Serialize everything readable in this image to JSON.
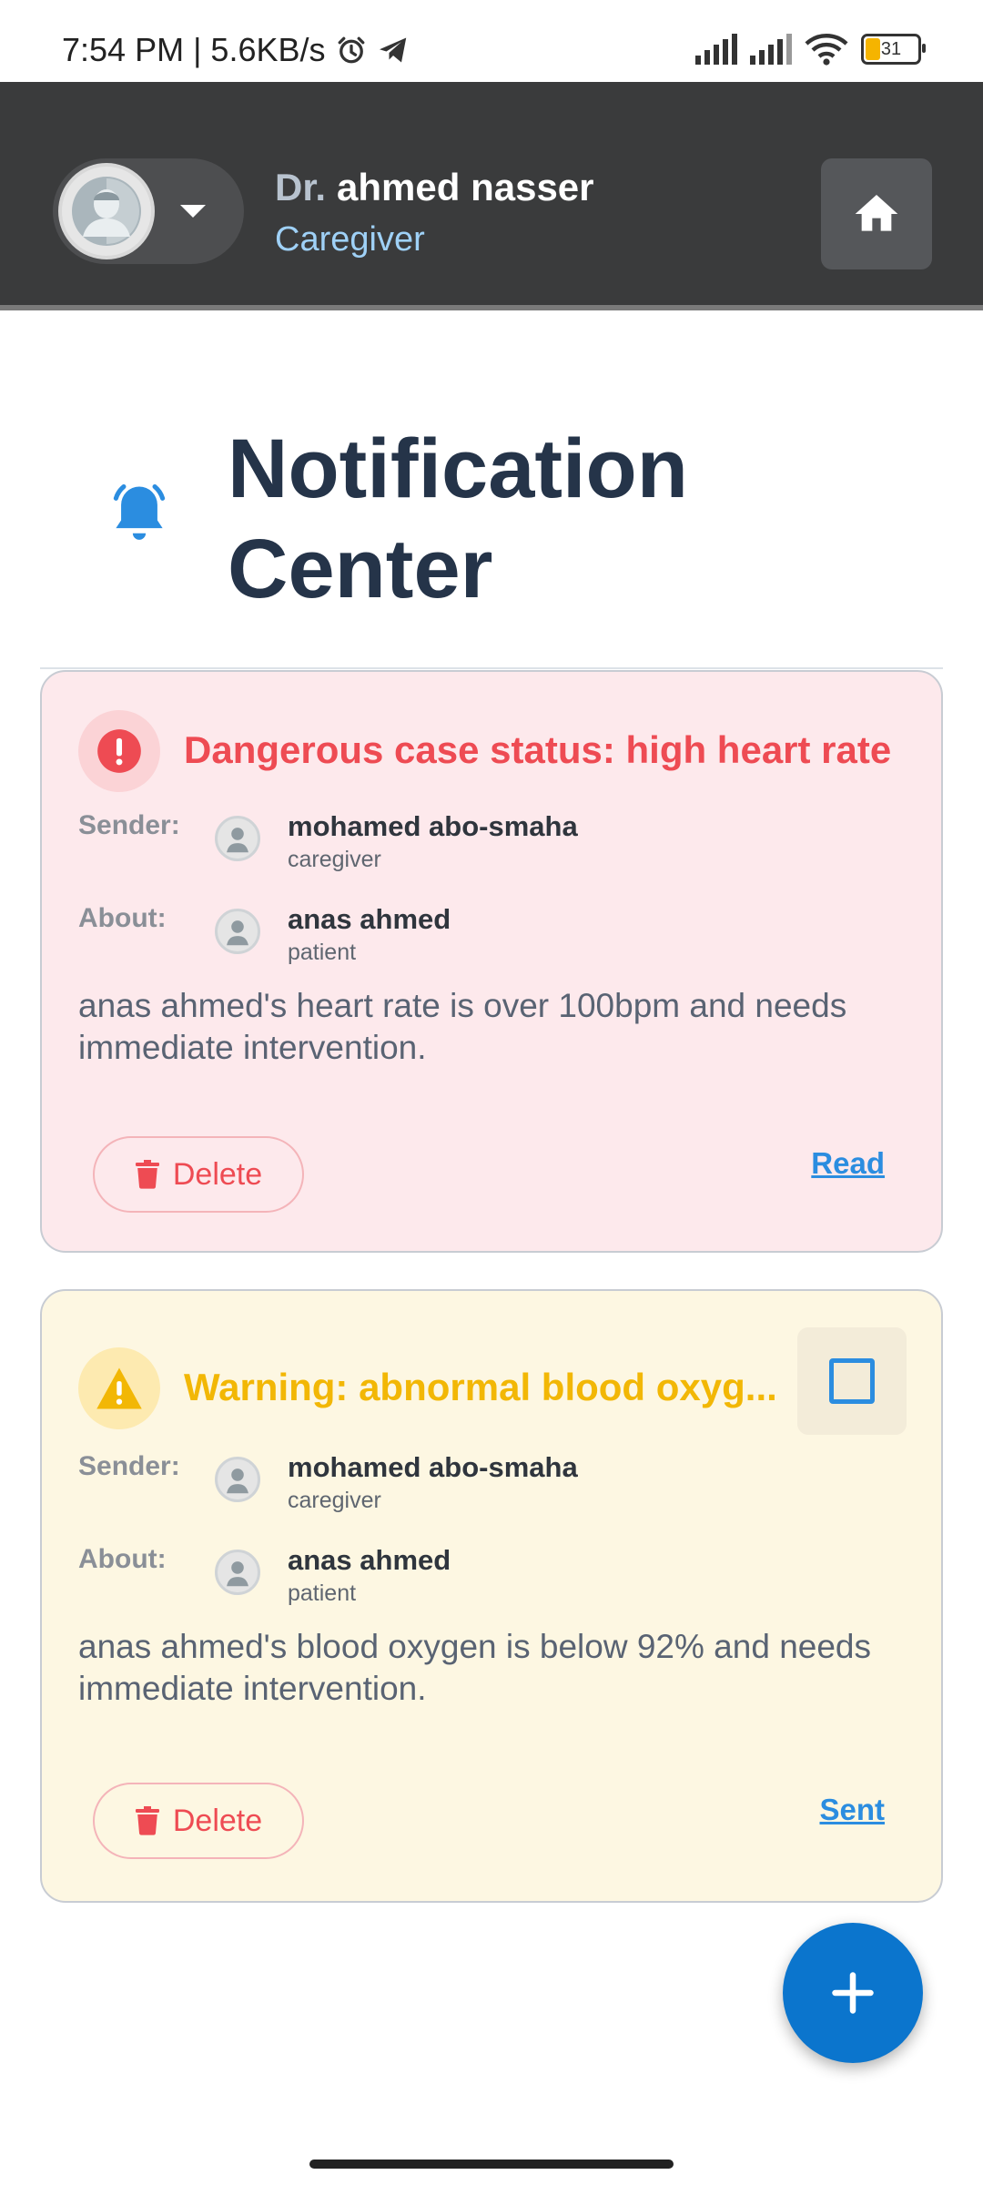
{
  "status_bar": {
    "time_speed": "7:54 PM | 5.6KB/s",
    "battery": "31"
  },
  "header": {
    "user_prefix": "Dr.",
    "user_name": "ahmed nasser",
    "user_role": "Caregiver",
    "icons": [
      "avatar",
      "caret-down-icon",
      "home-icon"
    ]
  },
  "page": {
    "title": "Notification Center",
    "icon": "bell-icon"
  },
  "notifications": [
    {
      "type": "danger",
      "title": "Dangerous case status: high heart rate",
      "sender_label": "Sender:",
      "sender_name": "mohamed abo-smaha",
      "sender_role": "caregiver",
      "about_label": "About:",
      "about_name": "anas ahmed",
      "about_role": "patient",
      "message": "anas ahmed's heart rate is over 100bpm and needs immediate intervention.",
      "delete_label": "Delete",
      "status": "Read",
      "accent": "#ee4b53"
    },
    {
      "type": "warning",
      "title": "Warning: abnormal blood oxyg...",
      "sender_label": "Sender:",
      "sender_name": "mohamed abo-smaha",
      "sender_role": "caregiver",
      "about_label": "About:",
      "about_name": "anas ahmed",
      "about_role": "patient",
      "message": "anas ahmed's blood oxygen is below 92% and needs immediate intervention.",
      "delete_label": "Delete",
      "status": "Sent",
      "accent": "#f2b705"
    }
  ],
  "fab": {
    "icon": "plus-icon"
  },
  "colors": {
    "appbar": "#3a3b3c",
    "title": "#253449",
    "link": "#2b8de0",
    "fab": "#0b75cd"
  }
}
